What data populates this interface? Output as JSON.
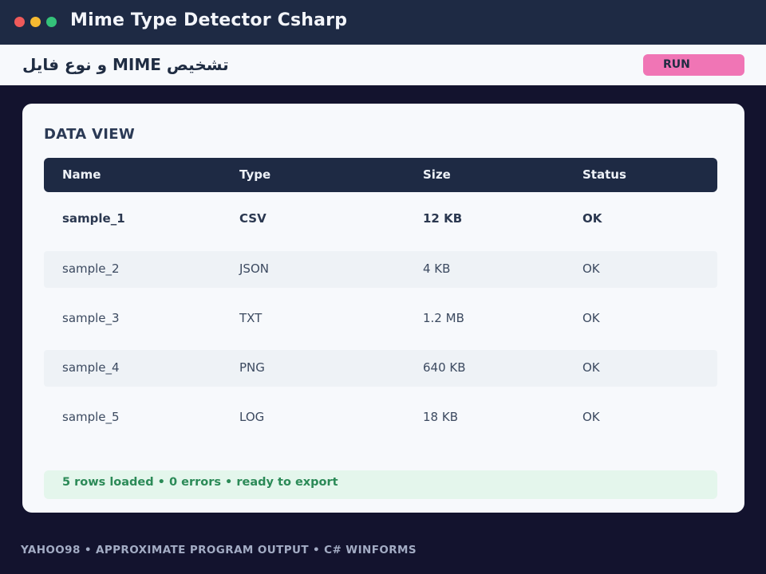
{
  "window": {
    "title": "Mime Type Detector Csharp"
  },
  "header": {
    "title": "تشخیص MIME و نوع فایل",
    "run_label": "RUN"
  },
  "main": {
    "section_title": "DATA VIEW",
    "table": {
      "columns": [
        "Name",
        "Type",
        "Size",
        "Status"
      ],
      "rows": [
        [
          "sample_1",
          "CSV",
          "12 KB",
          "OK"
        ],
        [
          "sample_2",
          "JSON",
          "4 KB",
          "OK"
        ],
        [
          "sample_3",
          "TXT",
          "1.2 MB",
          "OK"
        ],
        [
          "sample_4",
          "PNG",
          "640 KB",
          "OK"
        ],
        [
          "sample_5",
          "LOG",
          "18 KB",
          "OK"
        ]
      ]
    },
    "status": "5 rows loaded  •  0 errors  •  ready to export"
  },
  "footer": {
    "text": "YAHOO98  •  APPROXIMATE PROGRAM OUTPUT  •  C# WINFORMS"
  },
  "colors": {
    "titlebar": "#1e2a44",
    "background": "#13132e",
    "accent": "#f075b5",
    "status_ok": "#2b8a57"
  }
}
